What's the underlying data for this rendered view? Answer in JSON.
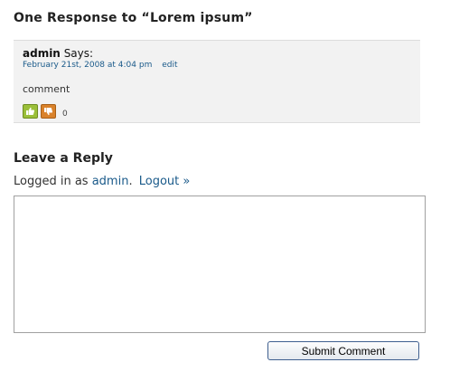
{
  "responses": {
    "title": "One Response to “Lorem ipsum”"
  },
  "comment": {
    "author": "admin",
    "says": "Says:",
    "date": "February 21st, 2008 at 4:04 pm",
    "edit_label": "edit",
    "text": "comment",
    "rating_count": "0"
  },
  "reply": {
    "title": "Leave a Reply",
    "logged_in_prefix": "Logged in as",
    "user_link": "admin",
    "logout_link": "Logout »",
    "comment_value": "",
    "submit_label": "Submit Comment"
  },
  "icons": {
    "thumb_up": "thumb-up-icon",
    "thumb_down": "thumb-down-icon"
  },
  "colors": {
    "link": "#1a5a8a",
    "comment_bg": "#f2f2f2",
    "thumb_up": "#9bbf3a",
    "thumb_down": "#d9822b"
  }
}
